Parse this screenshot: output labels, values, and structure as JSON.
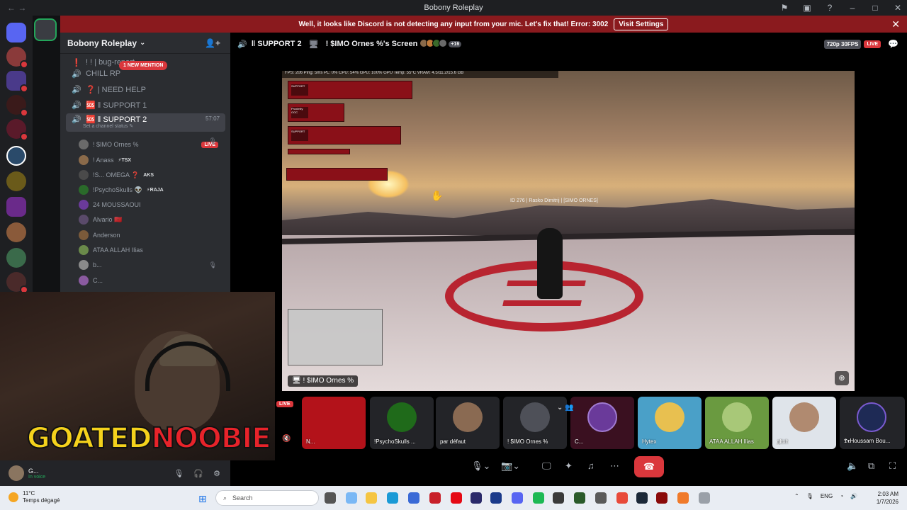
{
  "window": {
    "title": "Bobony Roleplay",
    "nav_back": "←",
    "nav_forward": "→",
    "controls": [
      "⚑",
      "▣",
      "?",
      "–",
      "□",
      "✕"
    ]
  },
  "notice": {
    "message": "Well, it looks like Discord is not detecting any input from your mic. Let's fix that!",
    "error": "Error: 3002",
    "button": "Visit Settings",
    "close": "✕"
  },
  "server": {
    "name": "Bobony Roleplay",
    "new_mention": "1 NEW MENTION"
  },
  "channels": [
    {
      "icon": "❗",
      "label": "! ! | bug-report"
    },
    {
      "icon": "🔊",
      "label": "CHILL RP"
    },
    {
      "icon": "🔊",
      "label": "❓ | NEED HELP"
    },
    {
      "icon": "🔊",
      "label": "🆘 ‖ SUPPORT 1"
    },
    {
      "icon": "🔊",
      "label": "🆘 ‖ SUPPORT 2",
      "timer": "57:07",
      "status": "Set a channel status ✎"
    }
  ],
  "voice_users": [
    {
      "name": "! $IMO Ornes %",
      "live": "LIVE"
    },
    {
      "name": "! Anass",
      "tag": "⚡TSX"
    },
    {
      "name": "!S... OMEGA ❓",
      "tag": "AKS"
    },
    {
      "name": "!PsychoSkulls 👽",
      "tag": "⚡RAJA"
    },
    {
      "name": "24 MOUSSAOUI"
    },
    {
      "name": "Alvario 🇲🇦"
    },
    {
      "name": "Anderson"
    },
    {
      "name": "ATAA ALLAH Ilias"
    },
    {
      "name": "b..."
    },
    {
      "name": "C..."
    }
  ],
  "self_user": {
    "name": "G...",
    "status": "In voice"
  },
  "stage": {
    "channel": "‖ SUPPORT 2",
    "screen_title": "! $IMO Ornes %'s Screen",
    "viewer_extra": "+16",
    "quality": "720p 30FPS",
    "live": "LIVE"
  },
  "game": {
    "hud": "FPS: 206   Ping: 5ms   PL: 0%   CPU: 54%   GPU: 100%   GPU Temp: 55°C   VRAM: 4.5/11.2/15.6 GB",
    "nametag": "ID 276 | Rasko Dimitrij | [SIMO ORNES]",
    "streamer_label": "! $IMO Ornes %",
    "chat": [
      {
        "tag": "SUPPORT"
      },
      {
        "tag": "Proximity OOC"
      },
      {
        "tag": "SUPPORT"
      }
    ]
  },
  "logo": {
    "part1": "GOATED",
    "part2": "NOOBIE"
  },
  "tiles": {
    "live_badge": "LIVE",
    "items": [
      {
        "label": "N...",
        "color": "#b3121a"
      },
      {
        "label": "!PsychoSkulls ...",
        "color": "#1f6a1a"
      },
      {
        "label": "par défaut",
        "color": "#8a6a52"
      },
      {
        "label": "! $IMO Ornes %",
        "color": "#2b2d31"
      },
      {
        "label": "C...",
        "color": "#3a1020"
      },
      {
        "label": "Hytex",
        "color": "#4aa0c8"
      },
      {
        "label": "ATAA ALLAH Ilias",
        "color": "#6a9a40"
      },
      {
        "label": "gltxh",
        "color": "#dfe4ea"
      },
      {
        "label": "𝕯𝖗Houssam Bou...",
        "color": "#1e2a55"
      }
    ]
  },
  "taskbar": {
    "temp": "11°C",
    "weather": "Temps dégagé",
    "search": "Search",
    "lang": "ENG",
    "time": "2:03 AM",
    "date": "1/7/2026"
  },
  "colors": {
    "accent_red": "#da373c",
    "bg_dark": "#2b2d31",
    "online": "#23a55a"
  }
}
